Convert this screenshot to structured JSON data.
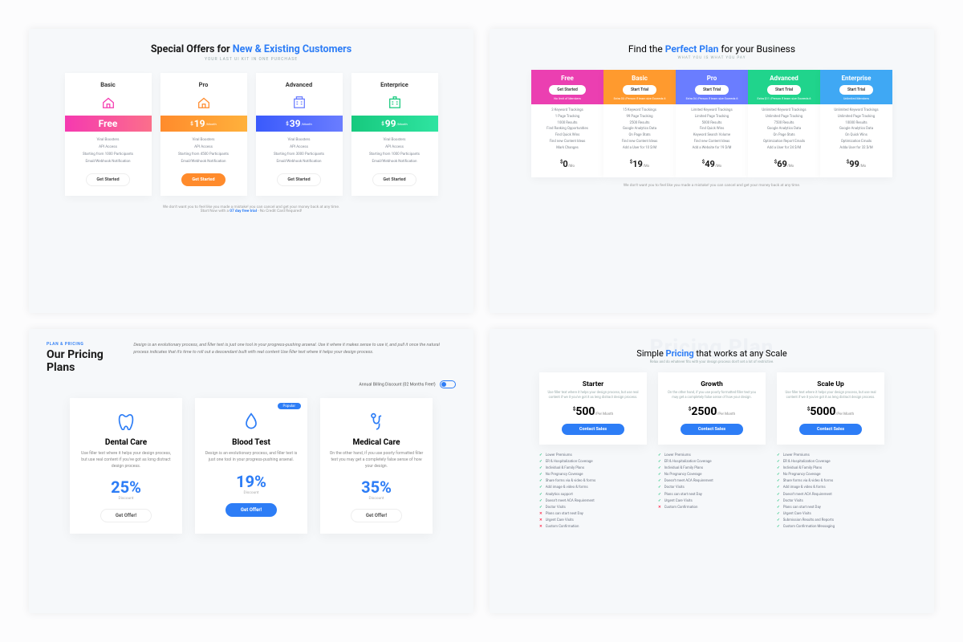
{
  "panelA": {
    "title_pre": "Special Offers for ",
    "title_accent": "New & Existing Customers",
    "subtitle": "YOUR LAST UI KIT IN ONE PURCHASE",
    "cards": [
      {
        "name": "Basic",
        "price": "Free",
        "per": "",
        "features": [
          "Viral Boosters",
          "API Access",
          "Starting from 1000 Participants",
          "Email/Webhook Notification"
        ],
        "cta": "Get Started"
      },
      {
        "name": "Pro",
        "price": "19",
        "per": "/Month",
        "features": [
          "Viral Boosters",
          "API Access",
          "Starting from 4500 Participants",
          "Email/Webhook Notification"
        ],
        "cta": "Get Started"
      },
      {
        "name": "Advanced",
        "price": "39",
        "per": "/Month",
        "features": [
          "Viral Boosters",
          "API Access",
          "Starting from 3000 Participants",
          "Email/Webhook Notification"
        ],
        "cta": "Get Started"
      },
      {
        "name": "Enterprice",
        "price": "99",
        "per": "/Month",
        "features": [
          "Viral Boosters",
          "API Access",
          "Starting from 1000 Participants",
          "Email/Webhook Notification"
        ],
        "cta": "Get Started"
      }
    ],
    "foot1": "We don't want you to feel like you made a mistake! you can cancel and get your money back at any time.",
    "foot2_pre": "Start Now with a ",
    "foot2_accent": "07 day free trial",
    "foot2_post": " - No Credit Card Required!"
  },
  "panelB": {
    "title_pre": "Find the ",
    "title_accent": "Perfect Plan",
    "title_post": " for your Business",
    "subtitle": "WHAT YOU IS WHAT YOU PAY",
    "cards": [
      {
        "name": "Free",
        "cta": "Get Started",
        "note": "No limit of Members",
        "feats": [
          "3 Keyword Trackings",
          "1 Page Tracking",
          "1000 Results",
          "Find Ranking Opportunities",
          "Find Quick Wins",
          "Find new Content Ideas",
          "Mark Changes"
        ],
        "price": "0"
      },
      {
        "name": "Basic",
        "cta": "Start Trial",
        "note": "Extra 03 /Person\nif team size Exceeds 6",
        "feats": [
          "15 Keyword Trackings",
          "99 Page Tracking",
          "2500 Results",
          "Google Analytics Data",
          "On Page Stats",
          "Find new Content Ideas",
          "Add a User for 10 $/M"
        ],
        "price": "19"
      },
      {
        "name": "Pro",
        "cta": "Start Trial",
        "note": "Extra 04 /Person\nif team size Exceeds 6",
        "feats": [
          "Limited Keyword Trackings",
          "Limited Page Tracking",
          "5000 Results",
          "Find Quick Wins",
          "Keyword Search Volume",
          "Find new Content Ideas",
          "Add a Website for 19 $/M"
        ],
        "price": "49"
      },
      {
        "name": "Advanced",
        "cta": "Start Trial",
        "note": "Extra $11 /Person\nif team size Exceeds 6",
        "feats": [
          "Unlimited Keyword Trackings",
          "Unlimited Page Tracking",
          "7500 Results",
          "Google Analytics Data",
          "On Page Stats",
          "Optimization Report Emails",
          "Add a User for 24 $/M"
        ],
        "price": "69"
      },
      {
        "name": "Enterprise",
        "cta": "Start Trial",
        "note": "Unlimited Members",
        "feats": [
          "Unlimited Keyword Trackings",
          "Unlimited Page Tracking",
          "10000 Results",
          "Google Analytics Data",
          "On Quick Wins",
          "Optimization Emails",
          "Adda User for 32 $/M"
        ],
        "price": "99"
      }
    ],
    "foot": "We don't want you to feel like you made a mistake! you can cancel and get your money back at any time."
  },
  "panelC": {
    "label": "PLAN & PRICING",
    "title": "Our Pricing Plans",
    "desc": "Design is an evolutionary process, and filler text is just one tool in your progress-pushing arsenal. Use it where it makes sense to use it, and pull it once the natural process indicates that it's time to roll out a descendant built with real content Use filler text where it helps your design process.",
    "toggle_label": "Annual Billing Discount (02 Months Free!)",
    "cards": [
      {
        "name": "Dental Care",
        "text": "Use filler text where it helps your design process, but use real content if you've got as long distract design process.",
        "pct": "25%",
        "cta": "Get Offer!",
        "popular": false
      },
      {
        "name": "Blood Test",
        "text": "Design is an evolutionary process, and filler text is just one tool in your progress-pushing arsenal.",
        "pct": "19%",
        "cta": "Get Offer!",
        "popular": true
      },
      {
        "name": "Medical Care",
        "text": "On the other hand, if you use poorly formatted filler text you may get a completely false sense of how your design.",
        "pct": "35%",
        "cta": "Get Offer!",
        "popular": false
      }
    ],
    "discount_label": "Discount",
    "popular_label": "Popular"
  },
  "panelD": {
    "bg": "Pricing Plan",
    "title_pre": "Simple ",
    "title_accent": "Pricing",
    "title_post": " that works at any Scale",
    "sub": "Relax and do whatever fits with your design process don't set a lot of restrictive.",
    "cards": [
      {
        "name": "Starter",
        "desc": "Use filler text where it helps your design process, but use real content if we it you've got it as leng distract design process.",
        "price": "500",
        "per": "/Per Month",
        "cta": "Contact Sales"
      },
      {
        "name": "Growth",
        "desc": "On the other hand, if you use poorly formatted filler text you may get a completely false sense of how your design.",
        "price": "2500",
        "per": "/Per Month",
        "cta": "Contact Sales"
      },
      {
        "name": "Scale Up",
        "desc": "Use filler text where it helps your design process, but use real content if we it you've got it as leng distract design process.",
        "price": "5000",
        "per": "/Per Month",
        "cta": "Contact Sales"
      }
    ],
    "lists": [
      [
        [
          "ok",
          "Lower Premiums"
        ],
        [
          "ok",
          "ER & Hospitalization Coverage"
        ],
        [
          "ok",
          "Individual & Family Plans"
        ],
        [
          "ok",
          "No Pregnancy Coverage"
        ],
        [
          "ok",
          "Share forms via & video & forms"
        ],
        [
          "ok",
          "Add image & video & forms"
        ],
        [
          "ok",
          "Analytics support"
        ],
        [
          "ok",
          "Doesn't meet ACA Requirement"
        ],
        [
          "ok",
          "Doctor Visits"
        ],
        [
          "no",
          "Plans can start next Day"
        ],
        [
          "no",
          "Urgent Care Visits"
        ],
        [
          "no",
          "Custom Confirmation"
        ]
      ],
      [
        [
          "ok",
          "Lower Premiums"
        ],
        [
          "ok",
          "ER & Hospitalization Coverage"
        ],
        [
          "ok",
          "Individual & Family Plans"
        ],
        [
          "ok",
          "No Pregnancy Coverage"
        ],
        [
          "ok",
          "Doesn't meet ACA Requirement"
        ],
        [
          "ok",
          "Doctor Visits"
        ],
        [
          "ok",
          "Plans can start next Day"
        ],
        [
          "ok",
          "Urgent Care Visits"
        ],
        [
          "no",
          "Custom Confirmation"
        ]
      ],
      [
        [
          "ok",
          "Lower Premiums"
        ],
        [
          "ok",
          "ER & Hospitalization Coverage"
        ],
        [
          "ok",
          "Individual & Family Plans"
        ],
        [
          "ok",
          "No Pregnancy Coverage"
        ],
        [
          "ok",
          "Share forms via & video & forms"
        ],
        [
          "ok",
          "Add image & video & forms"
        ],
        [
          "ok",
          "Doesn't meet ACA Requirement"
        ],
        [
          "ok",
          "Doctor Visits"
        ],
        [
          "ok",
          "Plans can start next Day"
        ],
        [
          "ok",
          "Urgent Care Visits"
        ],
        [
          "ok",
          "Submission Results and Reports"
        ],
        [
          "ok",
          "Custom Confirmation Messaging"
        ]
      ]
    ]
  }
}
